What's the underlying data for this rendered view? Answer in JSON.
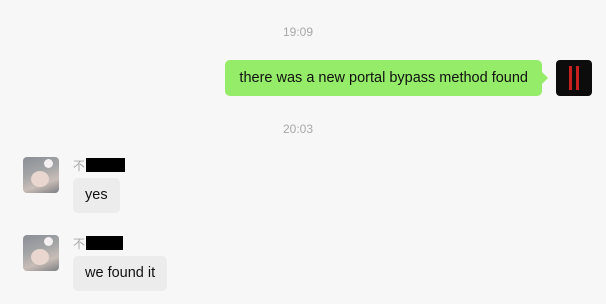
{
  "timestamps": [
    "19:09",
    "20:03"
  ],
  "outgoing": {
    "text": "there was a new portal bypass method found",
    "bubble_color": "#95ec69",
    "avatar_icon": "black-logo-avatar"
  },
  "incoming": [
    {
      "sender_prefix": "不",
      "sender_redacted": true,
      "text": "yes",
      "avatar_icon": "baby-photo-avatar"
    },
    {
      "sender_prefix": "不",
      "sender_redacted": true,
      "text": "we found it",
      "avatar_icon": "baby-photo-avatar"
    }
  ],
  "colors": {
    "background": "#f7f7f7",
    "incoming_bubble": "#ececec",
    "timestamp_text": "#a8a8a8",
    "redaction": "#000000"
  }
}
